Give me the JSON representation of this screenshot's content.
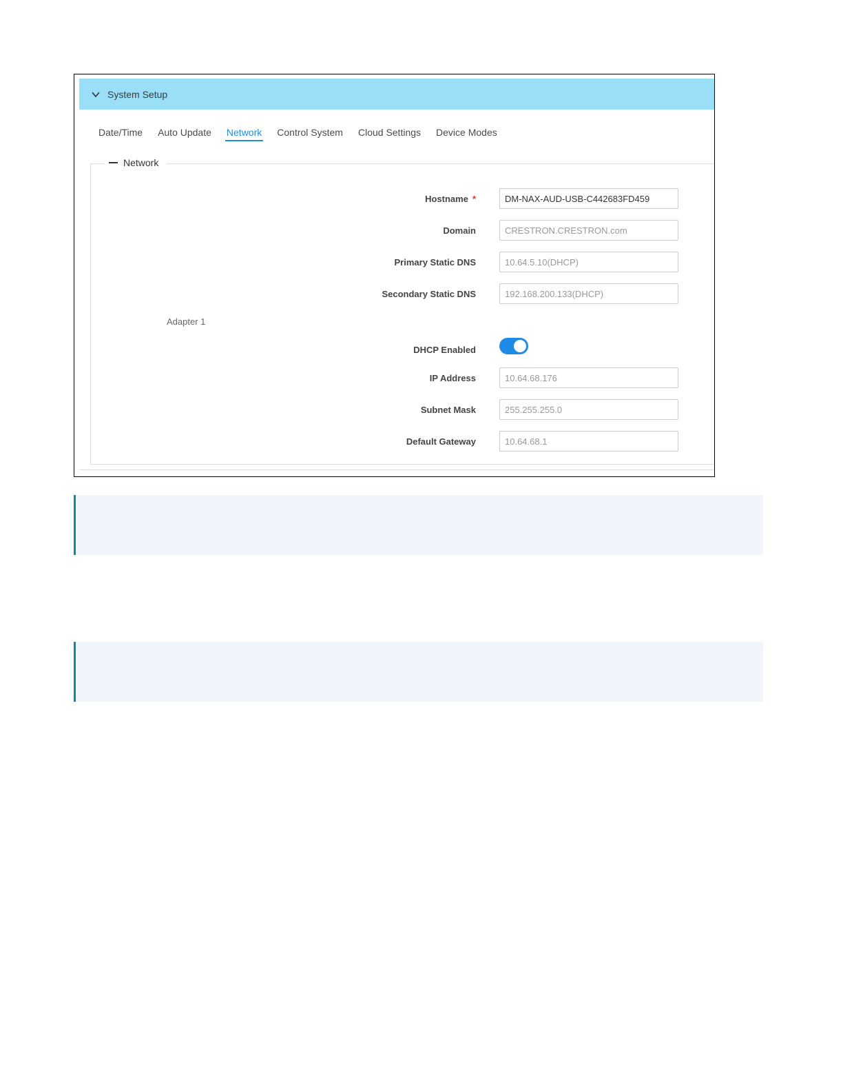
{
  "header": {
    "title": "System Setup",
    "icon": "chevron-down-icon",
    "bg_color": "#99dff7"
  },
  "tabs": [
    {
      "label": "Date/Time",
      "active": false
    },
    {
      "label": "Auto Update",
      "active": false
    },
    {
      "label": "Network",
      "active": true
    },
    {
      "label": "Control System",
      "active": false
    },
    {
      "label": "Cloud Settings",
      "active": false
    },
    {
      "label": "Device Modes",
      "active": false
    }
  ],
  "network": {
    "legend": "Network",
    "hostname": {
      "label": "Hostname",
      "required_mark": "*",
      "value": "DM-NAX-AUD-USB-C442683FD459"
    },
    "domain": {
      "label": "Domain",
      "value": "CRESTRON.CRESTRON.com"
    },
    "primary_dns": {
      "label": "Primary Static DNS",
      "value": "10.64.5.10(DHCP)"
    },
    "secondary_dns": {
      "label": "Secondary Static DNS",
      "value": "192.168.200.133(DHCP)"
    },
    "adapter_label": "Adapter 1",
    "dhcp": {
      "label": "DHCP Enabled",
      "enabled": true
    },
    "ip_address": {
      "label": "IP Address",
      "value": "10.64.68.176"
    },
    "subnet_mask": {
      "label": "Subnet Mask",
      "value": "255.255.255.0"
    },
    "default_gateway": {
      "label": "Default Gateway",
      "value": "10.64.68.1"
    }
  },
  "colors": {
    "accent": "#1e8fd6",
    "toggle_on": "#1e8be8",
    "note_border": "#1287a8",
    "note_bg": "#f0f5fb"
  }
}
